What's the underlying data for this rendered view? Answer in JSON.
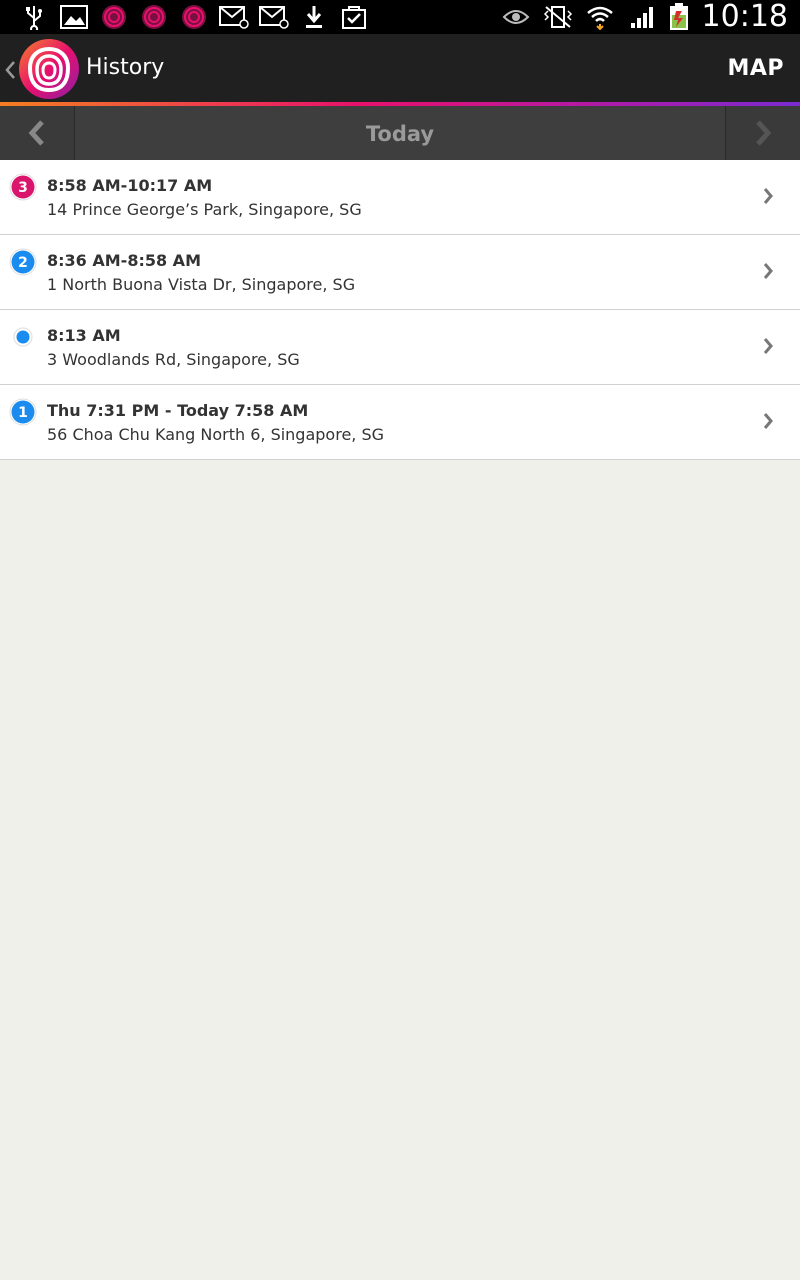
{
  "status_bar": {
    "left_icons": [
      "usb-icon",
      "gallery-icon",
      "life360-notification-icon",
      "life360-notification-icon",
      "life360-notification-icon",
      "email-icon",
      "email-icon",
      "download-icon",
      "shopping-bag-icon"
    ],
    "right_icons": [
      "eye-icon",
      "vibrate-off-icon",
      "wifi-icon",
      "signal-icon",
      "battery-charging-icon"
    ],
    "time": "10:18"
  },
  "action_bar": {
    "title": "History",
    "map_label": "MAP"
  },
  "day_nav": {
    "label": "Today"
  },
  "colors": {
    "pink_marker": "#d9166b",
    "blue_marker": "#1a8cf0",
    "actionbar_bg": "#202020",
    "daynav_bg": "#3e3e3e",
    "content_bg": "#f0f0eb"
  },
  "history": [
    {
      "marker": "3",
      "marker_color": "#d9166b",
      "time": "8:58 AM-10:17 AM",
      "address": "14 Prince George’s Park, Singapore, SG"
    },
    {
      "marker": "2",
      "marker_color": "#1a8cf0",
      "time": "8:36 AM-8:58 AM",
      "address": "1 North Buona Vista Dr, Singapore, SG"
    },
    {
      "marker": "",
      "marker_color": "#1a8cf0",
      "time": "8:13 AM",
      "address": "3 Woodlands Rd, Singapore, SG"
    },
    {
      "marker": "1",
      "marker_color": "#1a8cf0",
      "time": "Thu 7:31 PM - Today 7:58 AM",
      "address": "56 Choa Chu Kang North 6, Singapore, SG"
    }
  ]
}
